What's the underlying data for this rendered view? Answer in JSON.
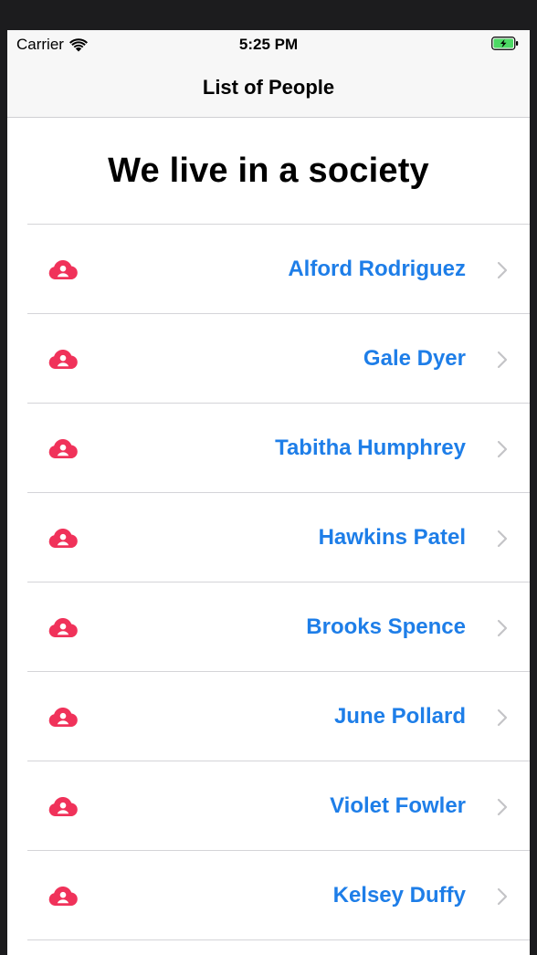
{
  "status_bar": {
    "carrier": "Carrier",
    "time": "5:25 PM",
    "wifi_icon": "wifi-icon",
    "battery_icon": "battery-charging-icon",
    "battery_color": "#4cd964"
  },
  "nav": {
    "title": "List of People"
  },
  "main": {
    "heading": "We live in a society"
  },
  "people": [
    {
      "name": "Alford Rodriguez"
    },
    {
      "name": "Gale Dyer"
    },
    {
      "name": "Tabitha Humphrey"
    },
    {
      "name": "Hawkins Patel"
    },
    {
      "name": "Brooks Spence"
    },
    {
      "name": "June Pollard"
    },
    {
      "name": "Violet Fowler"
    },
    {
      "name": "Kelsey Duffy"
    }
  ],
  "colors": {
    "accent": "#1e7ee8",
    "icon": "#f0325a",
    "chevron": "#c4c4c7",
    "separator": "#d4d4d8"
  },
  "icons": {
    "row_icon": "person-cloud-icon",
    "disclosure": "chevron-right-icon"
  }
}
